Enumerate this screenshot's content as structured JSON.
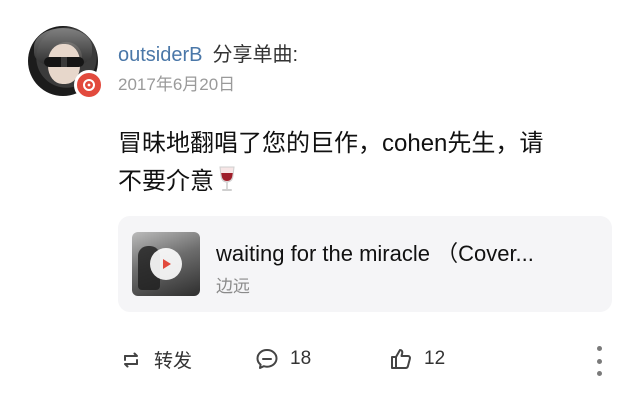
{
  "post": {
    "username": "outsiderB",
    "action": "分享单曲:",
    "date": "2017年6月20日",
    "content": "冒昧地翻唱了您的巨作，cohen先生，请\n不要介意",
    "emoji": "wine-glass-icon"
  },
  "song_card": {
    "title": "waiting for the miracle （Cover...",
    "artist": "边远"
  },
  "actions": {
    "repost_label": "转发",
    "comment_count": "18",
    "like_count": "12"
  },
  "colors": {
    "username": "#4a77a8",
    "music_badge": "#e24a3d",
    "card_bg": "#f5f5f7"
  }
}
